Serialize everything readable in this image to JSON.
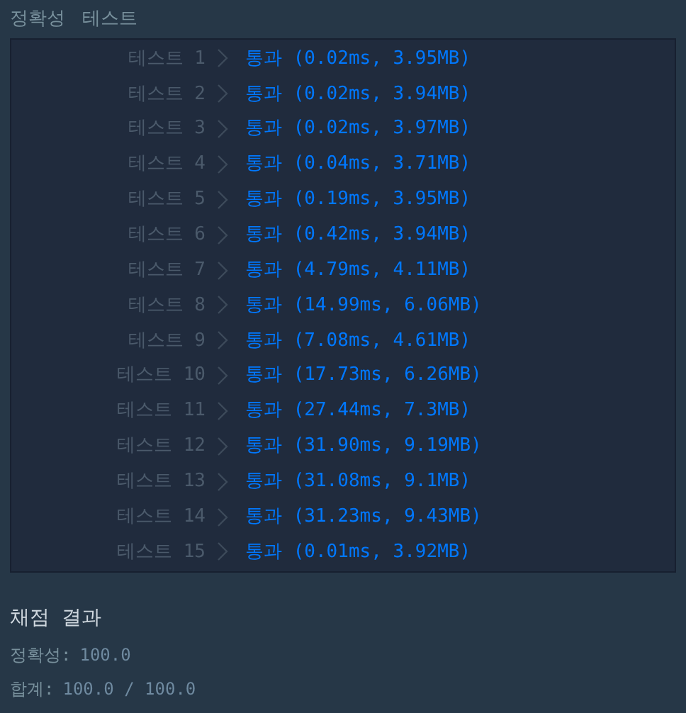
{
  "header": {
    "title": "정확성",
    "subtitle": "테스트"
  },
  "tests": [
    {
      "label": "테스트 1",
      "result": "통과 (0.02ms, 3.95MB)"
    },
    {
      "label": "테스트 2",
      "result": "통과 (0.02ms, 3.94MB)"
    },
    {
      "label": "테스트 3",
      "result": "통과 (0.02ms, 3.97MB)"
    },
    {
      "label": "테스트 4",
      "result": "통과 (0.04ms, 3.71MB)"
    },
    {
      "label": "테스트 5",
      "result": "통과 (0.19ms, 3.95MB)"
    },
    {
      "label": "테스트 6",
      "result": "통과 (0.42ms, 3.94MB)"
    },
    {
      "label": "테스트 7",
      "result": "통과 (4.79ms, 4.11MB)"
    },
    {
      "label": "테스트 8",
      "result": "통과 (14.99ms, 6.06MB)"
    },
    {
      "label": "테스트 9",
      "result": "통과 (7.08ms, 4.61MB)"
    },
    {
      "label": "테스트 10",
      "result": "통과 (17.73ms, 6.26MB)"
    },
    {
      "label": "테스트 11",
      "result": "통과 (27.44ms, 7.3MB)"
    },
    {
      "label": "테스트 12",
      "result": "통과 (31.90ms, 9.19MB)"
    },
    {
      "label": "테스트 13",
      "result": "통과 (31.08ms, 9.1MB)"
    },
    {
      "label": "테스트 14",
      "result": "통과 (31.23ms, 9.43MB)"
    },
    {
      "label": "테스트 15",
      "result": "통과 (0.01ms, 3.92MB)"
    }
  ],
  "summary": {
    "title": "채점 결과",
    "lines": [
      {
        "label": "정확성:",
        "value": "100.0"
      },
      {
        "label": "합계:",
        "value": "100.0 / 100.0"
      }
    ]
  }
}
